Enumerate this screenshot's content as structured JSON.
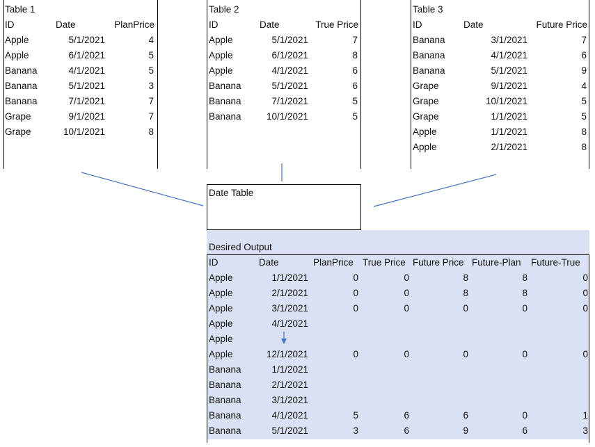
{
  "tables": [
    {
      "title": "Table 1",
      "headers": [
        "ID",
        "Date",
        "PlanPrice"
      ],
      "rows": [
        [
          "Apple",
          "5/1/2021",
          "4"
        ],
        [
          "Apple",
          "6/1/2021",
          "5"
        ],
        [
          "Banana",
          "4/1/2021",
          "5"
        ],
        [
          "Banana",
          "5/1/2021",
          "3"
        ],
        [
          "Banana",
          "7/1/2021",
          "7"
        ],
        [
          "Grape",
          "9/1/2021",
          "7"
        ],
        [
          "Grape",
          "10/1/2021",
          "8"
        ]
      ]
    },
    {
      "title": "Table 2",
      "headers": [
        "ID",
        "Date",
        "True Price"
      ],
      "rows": [
        [
          "Apple",
          "5/1/2021",
          "7"
        ],
        [
          "Apple",
          "6/1/2021",
          "8"
        ],
        [
          "Apple",
          "4/1/2021",
          "6"
        ],
        [
          "Banana",
          "5/1/2021",
          "6"
        ],
        [
          "Banana",
          "7/1/2021",
          "5"
        ],
        [
          "Banana",
          "10/1/2021",
          "5"
        ]
      ]
    },
    {
      "title": "Table 3",
      "headers": [
        "ID",
        "Date",
        "Future Price"
      ],
      "rows": [
        [
          "Banana",
          "3/1/2021",
          "7"
        ],
        [
          "Banana",
          "4/1/2021",
          "6"
        ],
        [
          "Banana",
          "5/1/2021",
          "9"
        ],
        [
          "Grape",
          "9/1/2021",
          "4"
        ],
        [
          "Grape",
          "10/1/2021",
          "5"
        ],
        [
          "Grape",
          "1/1/2021",
          "5"
        ],
        [
          "Apple",
          "1/1/2021",
          "8"
        ],
        [
          "Apple",
          "2/1/2021",
          "8"
        ]
      ]
    }
  ],
  "date_table": {
    "title": "Date Table"
  },
  "output": {
    "title": "Desired Output",
    "headers": [
      "ID",
      "Date",
      "PlanPrice",
      "True Price",
      "Future Price",
      "Future-Plan",
      "Future-True"
    ],
    "rows": [
      [
        "Apple",
        "1/1/2021",
        "0",
        "0",
        "8",
        "8",
        "0"
      ],
      [
        "Apple",
        "2/1/2021",
        "0",
        "0",
        "8",
        "8",
        "0"
      ],
      [
        "Apple",
        "3/1/2021",
        "0",
        "0",
        "0",
        "0",
        "0"
      ],
      [
        "Apple",
        "4/1/2021",
        "",
        "",
        "",
        "",
        ""
      ],
      [
        "Apple",
        "",
        "",
        "",
        "",
        "",
        ""
      ],
      [
        "Apple",
        "12/1/2021",
        "0",
        "0",
        "0",
        "0",
        "0"
      ],
      [
        "Banana",
        "1/1/2021",
        "",
        "",
        "",
        "",
        ""
      ],
      [
        "Banana",
        "2/1/2021",
        "",
        "",
        "",
        "",
        ""
      ],
      [
        "Banana",
        "3/1/2021",
        "",
        "",
        "",
        "",
        ""
      ],
      [
        "Banana",
        "4/1/2021",
        "5",
        "6",
        "6",
        "0",
        "1"
      ],
      [
        "Banana",
        "5/1/2021",
        "3",
        "6",
        "9",
        "6",
        "3"
      ]
    ],
    "background": "#d9e1f2"
  },
  "connector_color": "#4472c4"
}
